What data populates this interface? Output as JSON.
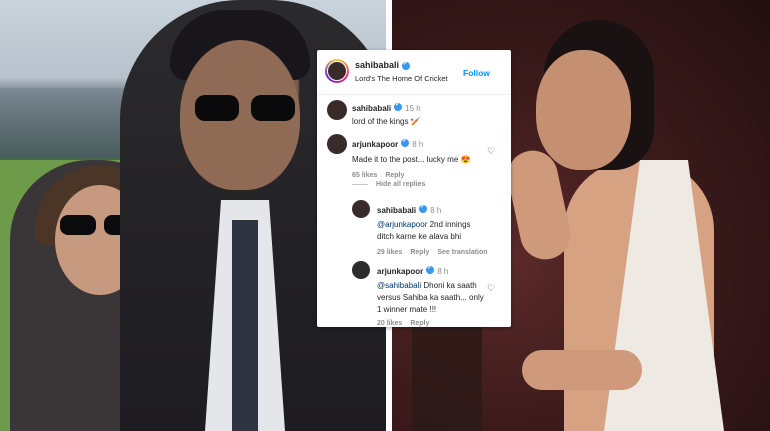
{
  "post": {
    "username": "sahibabali",
    "location": "Lord's The Home Of Cricket",
    "follow_label": "Follow",
    "more_label": "•••"
  },
  "caption": {
    "username": "sahibabali",
    "time": "15 h",
    "text": "lord of the kings 🏏"
  },
  "comments": [
    {
      "username": "arjunkapoor",
      "time": "8 h",
      "text": "Made it to the post... lucky me 😍",
      "likes": "65 likes",
      "reply": "Reply"
    }
  ],
  "hide_replies_label": "Hide all replies",
  "replies": [
    {
      "username": "sahibabali",
      "time": "8 h",
      "mention": "@arjunkapoor",
      "text": "2nd innings ditch karne ke alava bhi",
      "likes": "29 likes",
      "reply": "Reply",
      "translation": "See translation"
    },
    {
      "username": "arjunkapoor",
      "time": "8 h",
      "mention": "@sahibabali",
      "text": "Dhoni ka saath versus Sahiba ka saath... only 1 winner mate !!!",
      "likes": "20 likes",
      "reply": "Reply"
    }
  ],
  "colors": {
    "accent": "#0095f6",
    "verified": "#3897f0",
    "mention": "#00376b",
    "muted": "#8e8e8e"
  },
  "icons": {
    "verified": "verified-badge-icon",
    "heart": "heart-icon",
    "more": "more-options-icon"
  }
}
